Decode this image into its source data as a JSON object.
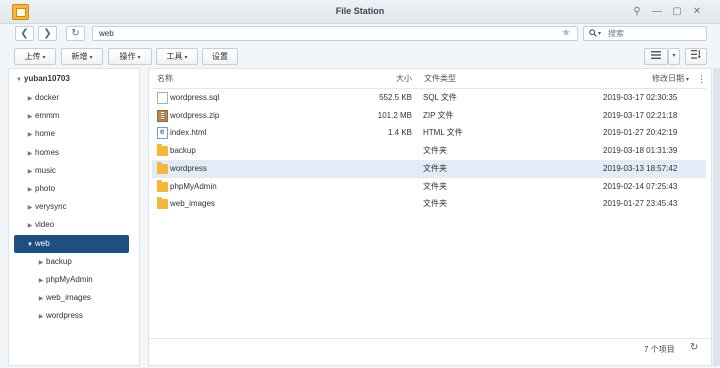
{
  "window": {
    "title": "File Station",
    "controls": {
      "pin": "⚲",
      "minimize": "—",
      "maximize": "▢",
      "close": "✕"
    }
  },
  "nav": {
    "back": "❮",
    "forward": "❯",
    "refresh": "↻",
    "path": "web",
    "favorite_icon": "★",
    "search_placeholder": "搜索"
  },
  "toolbar": {
    "upload": "上传",
    "create": "新增",
    "action": "操作",
    "tools": "工具",
    "settings": "设置"
  },
  "sidebar": {
    "root": "yuban10703",
    "items": [
      {
        "label": "docker"
      },
      {
        "label": "emmm"
      },
      {
        "label": "home"
      },
      {
        "label": "homes"
      },
      {
        "label": "music"
      },
      {
        "label": "photo"
      },
      {
        "label": "verysync"
      },
      {
        "label": "video"
      },
      {
        "label": "web",
        "selected": true
      },
      {
        "label": "backup",
        "child": true
      },
      {
        "label": "phpMyAdmin",
        "child": true
      },
      {
        "label": "web_images",
        "child": true
      },
      {
        "label": "wordpress",
        "child": true
      }
    ]
  },
  "table": {
    "columns": {
      "name": "名称",
      "size": "大小",
      "type": "文件类型",
      "modified": "修改日期"
    },
    "rows": [
      {
        "icon": "sql-file-icon",
        "name": "wordpress.sql",
        "size": "552.5 KB",
        "type": "SQL 文件",
        "modified": "2019-03-17 02:30:35"
      },
      {
        "icon": "zip-file-icon",
        "name": "wordpress.zip",
        "size": "101.2 MB",
        "type": "ZIP 文件",
        "modified": "2019-03-17 02:21:18"
      },
      {
        "icon": "html-file-icon",
        "name": "index.html",
        "size": "1.4 KB",
        "type": "HTML 文件",
        "modified": "2019-01-27 20:42:19"
      },
      {
        "icon": "folder-icon",
        "name": "backup",
        "size": "",
        "type": "文件夹",
        "modified": "2019-03-18 01:31:39"
      },
      {
        "icon": "folder-icon",
        "name": "wordpress",
        "size": "",
        "type": "文件夹",
        "modified": "2019-03-13 18:57:42",
        "highlight": true
      },
      {
        "icon": "folder-icon",
        "name": "phpMyAdmin",
        "size": "",
        "type": "文件夹",
        "modified": "2019-02-14 07:25:43"
      },
      {
        "icon": "folder-icon",
        "name": "web_images",
        "size": "",
        "type": "文件夹",
        "modified": "2019-01-27 23:45:43"
      }
    ]
  },
  "footer": {
    "count": "7 个项目",
    "refresh": "↻"
  }
}
